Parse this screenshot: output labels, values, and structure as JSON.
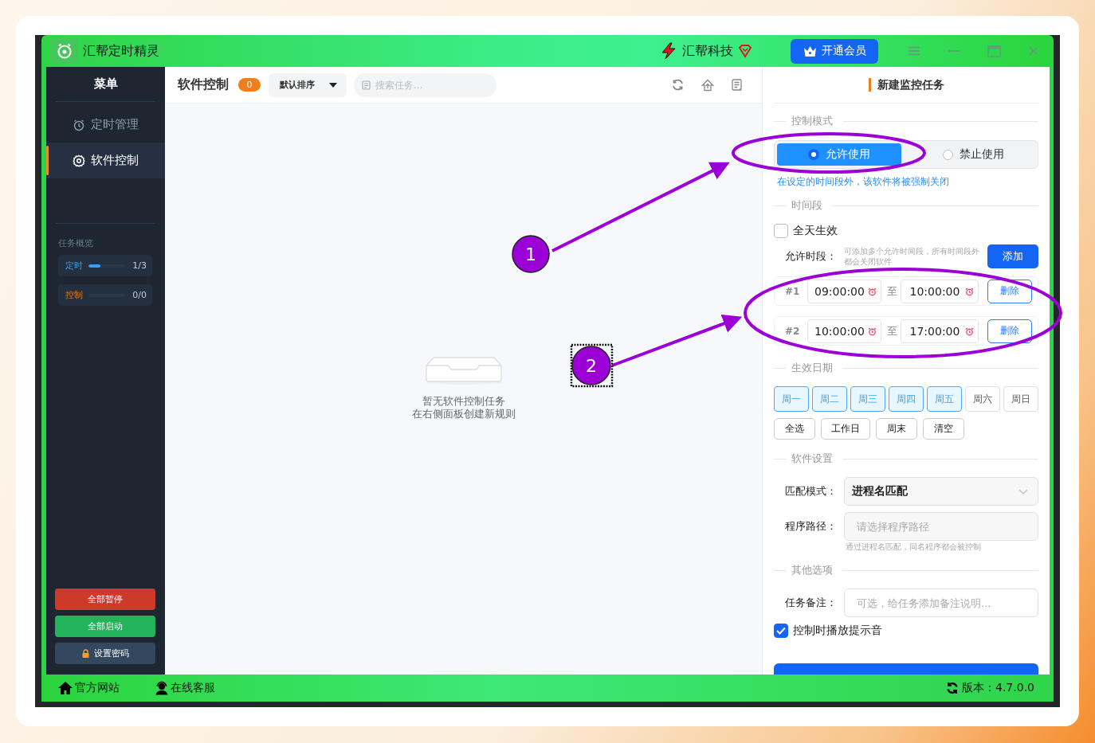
{
  "window": {
    "title": "汇帮定时精灵",
    "brand": "汇帮科技",
    "vip_button": "开通会员"
  },
  "sidebar": {
    "title": "菜单",
    "items": [
      {
        "label": "定时管理",
        "kind": "clock",
        "selected": false
      },
      {
        "label": "软件控制",
        "kind": "gear",
        "selected": true
      }
    ],
    "overview_title": "任务概览",
    "stats": [
      {
        "label": "定时",
        "kind": "timer",
        "level": 0.33,
        "reading": "1/3"
      },
      {
        "label": "控制",
        "kind": "control",
        "level": 0,
        "reading": "0/0"
      }
    ],
    "actions": [
      {
        "label": "全部暂停",
        "kind": "danger"
      },
      {
        "label": "全部启动",
        "kind": "success"
      },
      {
        "label": "设置密码",
        "kind": "lock"
      }
    ]
  },
  "main": {
    "title": "软件控制",
    "count": "0",
    "sort": "默认排序",
    "search": {
      "placeholder": "搜索任务..."
    },
    "empty_lines": [
      "暂无软件控制任务",
      "在右侧面板创建新规则"
    ]
  },
  "panel": {
    "title": "新建监控任务",
    "mode_label": "控制模式",
    "modes": [
      {
        "label": "允许使用",
        "selected": true
      },
      {
        "label": "禁止使用",
        "selected": false
      }
    ],
    "mode_hint": "在设定的时间段外，该软件将被强制关闭",
    "period_label": "时间段",
    "all_day": {
      "label": "全天生效",
      "checked": false
    },
    "periods_label": "允许时段：",
    "periods_hint": "可添加多个允许时间段，所有时间段外都会关闭软件",
    "add_button": "添加",
    "periods": [
      {
        "index": "#1",
        "start": "09:00:00",
        "separator": "至",
        "end": "10:00:00",
        "delete": "删除"
      },
      {
        "index": "#2",
        "start": "10:00:00",
        "separator": "至",
        "end": "17:00:00",
        "delete": "删除"
      }
    ],
    "date_label": "生效日期",
    "days": [
      {
        "label": "周一",
        "selected": true
      },
      {
        "label": "周二",
        "selected": true
      },
      {
        "label": "周三",
        "selected": true
      },
      {
        "label": "周四",
        "selected": true
      },
      {
        "label": "周五",
        "selected": true
      },
      {
        "label": "周六",
        "selected": false
      },
      {
        "label": "周日",
        "selected": false
      }
    ],
    "quick_buttons": [
      "全选",
      "工作日",
      "周末",
      "清空"
    ],
    "software_label": "软件设置",
    "match": {
      "label": "匹配模式：",
      "value": "进程名匹配"
    },
    "path": {
      "label": "程序路径：",
      "placeholder": "请选择程序路径",
      "hint": "通过进程名匹配，同名程序都会被控制"
    },
    "other_label": "其他选项",
    "note": {
      "label": "任务备注：",
      "placeholder": "可选，给任务添加备注说明..."
    },
    "sound": {
      "label": "控制时播放提示音",
      "checked": true
    }
  },
  "status_bar": {
    "links": [
      {
        "label": "官方网站",
        "kind": "home"
      },
      {
        "label": "在线客服",
        "kind": "support"
      }
    ],
    "version": "版本：4.7.0.0"
  },
  "annotations": [
    {
      "label": "1"
    },
    {
      "label": "2"
    }
  ]
}
